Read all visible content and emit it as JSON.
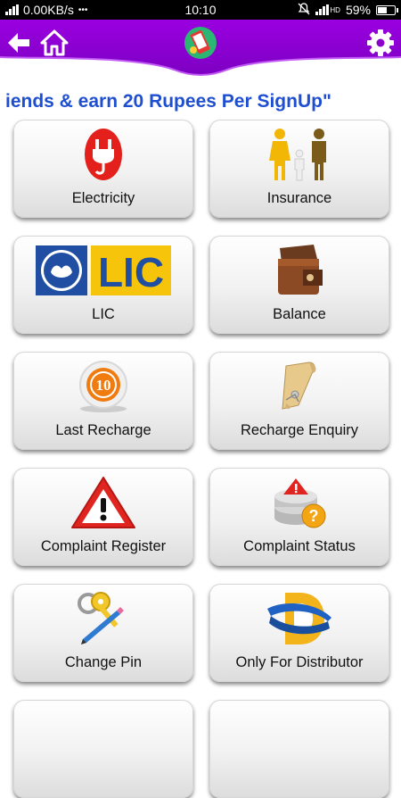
{
  "status_bar": {
    "network_speed": "0.00KB/s",
    "dots": "•••",
    "time": "10:10",
    "volte": "HD",
    "battery": "59%",
    "battery_level": 0.59
  },
  "header": {
    "back_icon": "arrow-left-icon",
    "home_icon": "home-icon",
    "logo_icon": "recharge-app-logo-icon",
    "settings_icon": "gear-icon",
    "colors": {
      "purple": "#8a00cc",
      "accent": "#1f4fd1"
    }
  },
  "marquee": {
    "text": "iends & earn 20 Rupees Per SignUp\""
  },
  "tiles": [
    {
      "label": "Electricity",
      "icon": "electric-plug-icon"
    },
    {
      "label": "Insurance",
      "icon": "family-icon"
    },
    {
      "label": "LIC",
      "icon": "lic-logo-icon",
      "logo_text": "LIC"
    },
    {
      "label": "Balance",
      "icon": "wallet-icon"
    },
    {
      "label": "Last Recharge",
      "icon": "number-badge-icon",
      "badge_text": "10"
    },
    {
      "label": "Recharge Enquiry",
      "icon": "receipt-scroll-icon"
    },
    {
      "label": "Complaint Register",
      "icon": "warning-icon"
    },
    {
      "label": "Complaint Status",
      "icon": "database-question-icon"
    },
    {
      "label": "Change Pin",
      "icon": "keys-pencil-icon"
    },
    {
      "label": "Only For Distributor",
      "icon": "distributor-d-icon"
    }
  ]
}
